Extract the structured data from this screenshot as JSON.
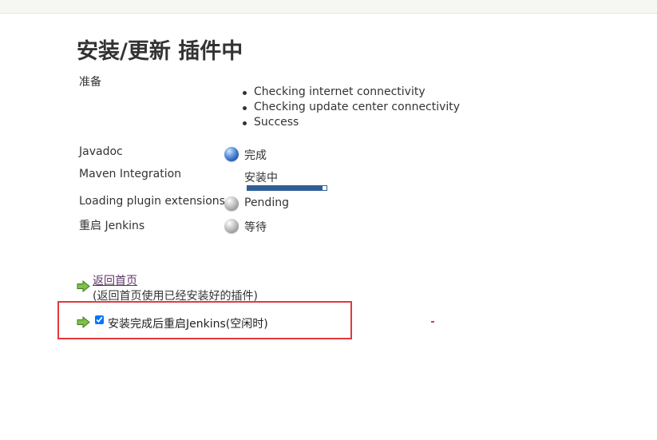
{
  "page": {
    "title": "安装/更新 插件中"
  },
  "preparation": {
    "label": "准备",
    "checks": [
      "Checking internet connectivity",
      "Checking update center connectivity",
      "Success"
    ]
  },
  "jobs": [
    {
      "name": "Javadoc",
      "status_icon": "blue-ball-icon",
      "status": "完成"
    },
    {
      "name": "Maven Integration",
      "status_icon": "progress-bar",
      "status": "安装中",
      "progress_fraction": 0.95
    },
    {
      "name": "Loading plugin extensions",
      "status_icon": "grey-ball-icon",
      "status": "Pending"
    },
    {
      "name": "重启 Jenkins",
      "status_icon": "grey-ball-icon",
      "status": "等待"
    }
  ],
  "actions": {
    "home_link": "返回首页",
    "home_desc": "(返回首页使用已经安装好的插件)",
    "restart_label": "安装完成后重启Jenkins(空闲时)",
    "restart_checked": true
  },
  "colors": {
    "link": "#5c3566",
    "progress": "#2f5f96",
    "highlight": "#e0393e",
    "arrow": "#6aa84f"
  }
}
